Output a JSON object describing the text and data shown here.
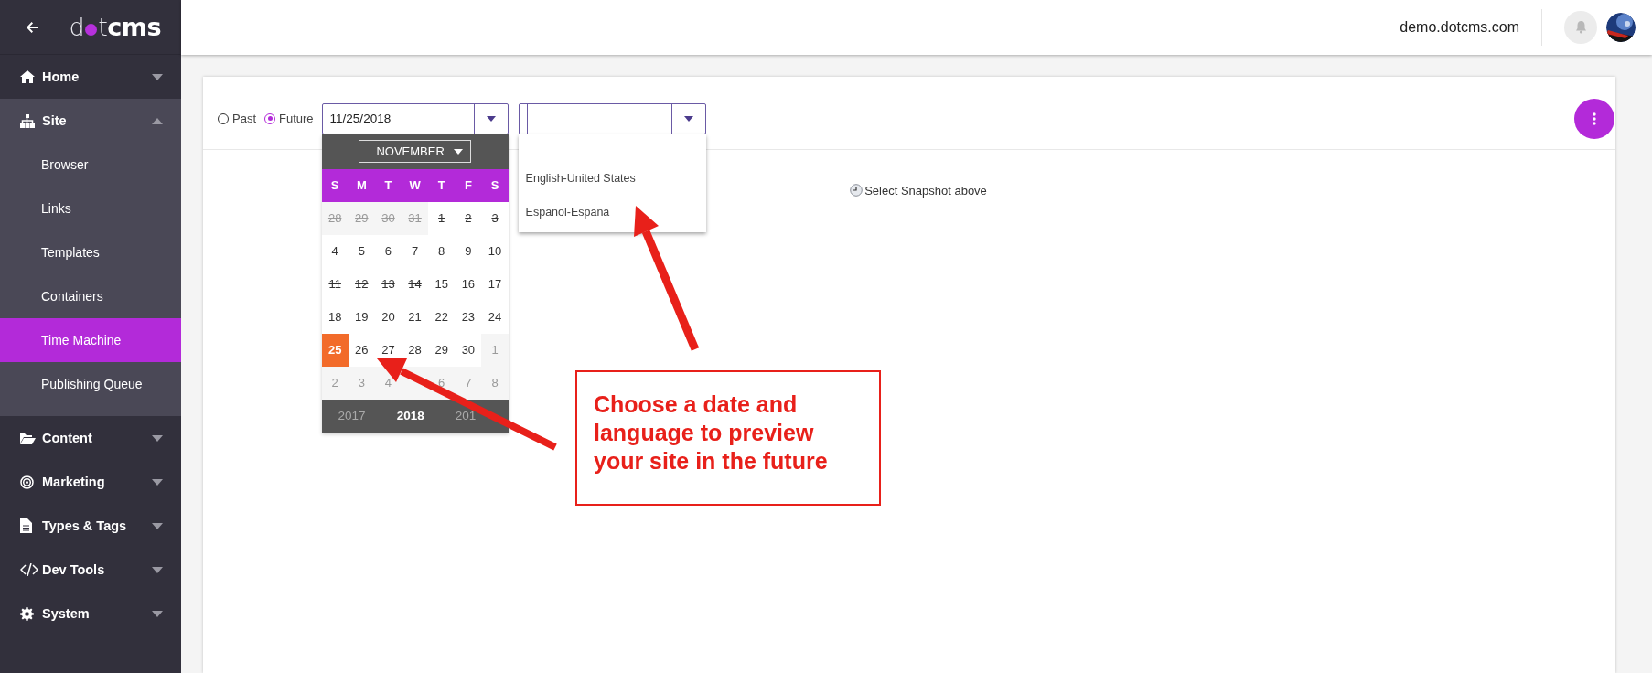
{
  "logo": {
    "light_start": "d",
    "light_end": "t",
    "bold": "cms"
  },
  "sidebar": {
    "items": [
      {
        "label": "Home",
        "kind": "home",
        "expanded": false
      },
      {
        "label": "Site",
        "kind": "sitemap",
        "expanded": true,
        "children": [
          {
            "label": "Browser",
            "selected": false
          },
          {
            "label": "Links",
            "selected": false
          },
          {
            "label": "Templates",
            "selected": false
          },
          {
            "label": "Containers",
            "selected": false
          },
          {
            "label": "Time Machine",
            "selected": true
          },
          {
            "label": "Publishing Queue",
            "selected": false
          }
        ]
      },
      {
        "label": "Content",
        "kind": "folder",
        "expanded": false
      },
      {
        "label": "Marketing",
        "kind": "target",
        "expanded": false
      },
      {
        "label": "Types & Tags",
        "kind": "file",
        "expanded": false
      },
      {
        "label": "Dev Tools",
        "kind": "code",
        "expanded": false
      },
      {
        "label": "System",
        "kind": "gear",
        "expanded": false
      }
    ]
  },
  "header": {
    "site": "demo.dotcms.com"
  },
  "toolbar": {
    "modes": [
      {
        "label": "Past",
        "selected": false
      },
      {
        "label": "Future",
        "selected": true
      }
    ],
    "date_field": {
      "value": "11/25/2018"
    },
    "language_field": {
      "expanded": true,
      "options": [
        "English-United States",
        "Espanol-Espana"
      ]
    }
  },
  "calendar": {
    "month": "NOVEMBER",
    "weekdays": [
      "S",
      "M",
      "T",
      "W",
      "T",
      "F",
      "S"
    ],
    "weeks": [
      [
        {
          "day": "28",
          "muted": true,
          "struck": true
        },
        {
          "day": "29",
          "muted": true,
          "struck": true
        },
        {
          "day": "30",
          "muted": true,
          "struck": true
        },
        {
          "day": "31",
          "muted": true,
          "struck": true
        },
        {
          "day": "1",
          "muted": false,
          "struck": true
        },
        {
          "day": "2",
          "muted": false,
          "struck": true
        },
        {
          "day": "3",
          "muted": false,
          "struck": true
        }
      ],
      [
        {
          "day": "4",
          "muted": false,
          "struck": false
        },
        {
          "day": "5",
          "muted": false,
          "struck": true
        },
        {
          "day": "6",
          "muted": false,
          "struck": false
        },
        {
          "day": "7",
          "muted": false,
          "struck": true
        },
        {
          "day": "8",
          "muted": false,
          "struck": false
        },
        {
          "day": "9",
          "muted": false,
          "struck": false
        },
        {
          "day": "10",
          "muted": false,
          "struck": true
        }
      ],
      [
        {
          "day": "11",
          "muted": false,
          "struck": true
        },
        {
          "day": "12",
          "muted": false,
          "struck": true
        },
        {
          "day": "13",
          "muted": false,
          "struck": true
        },
        {
          "day": "14",
          "muted": false,
          "struck": true
        },
        {
          "day": "15",
          "muted": false,
          "struck": false
        },
        {
          "day": "16",
          "muted": false,
          "struck": false
        },
        {
          "day": "17",
          "muted": false,
          "struck": false
        }
      ],
      [
        {
          "day": "18",
          "muted": false,
          "struck": false
        },
        {
          "day": "19",
          "muted": false,
          "struck": false
        },
        {
          "day": "20",
          "muted": false,
          "struck": false
        },
        {
          "day": "21",
          "muted": false,
          "struck": false
        },
        {
          "day": "22",
          "muted": false,
          "struck": false
        },
        {
          "day": "23",
          "muted": false,
          "struck": false
        },
        {
          "day": "24",
          "muted": false,
          "struck": false
        }
      ],
      [
        {
          "day": "25",
          "muted": false,
          "struck": false,
          "selected": true
        },
        {
          "day": "26",
          "muted": false,
          "struck": false
        },
        {
          "day": "27",
          "muted": false,
          "struck": false
        },
        {
          "day": "28",
          "muted": false,
          "struck": false
        },
        {
          "day": "29",
          "muted": false,
          "struck": false
        },
        {
          "day": "30",
          "muted": false,
          "struck": false
        },
        {
          "day": "1",
          "muted": true,
          "struck": false
        }
      ],
      [
        {
          "day": "2",
          "muted": true,
          "struck": false
        },
        {
          "day": "3",
          "muted": true,
          "struck": false
        },
        {
          "day": "4",
          "muted": true,
          "struck": false
        },
        {
          "day": "6",
          "muted": true,
          "struck": false
        },
        {
          "day": "7",
          "muted": true,
          "struck": false
        },
        {
          "day": "8",
          "muted": true,
          "struck": false
        }
      ]
    ],
    "years": [
      {
        "label": "2017",
        "selected": false
      },
      {
        "label": "2018",
        "selected": true
      },
      {
        "label": "201",
        "selected": false
      }
    ]
  },
  "content": {
    "message": "Select Snapshot above"
  },
  "annotation": {
    "text": "Choose a date and language to preview your site in the future"
  }
}
